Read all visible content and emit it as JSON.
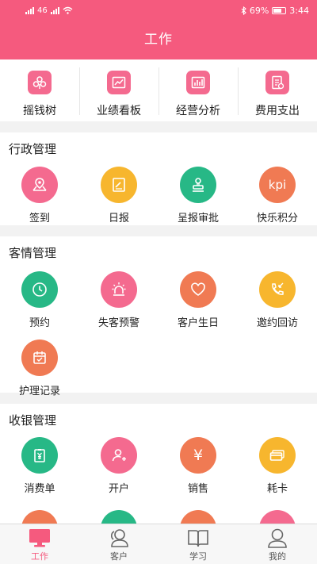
{
  "status_bar": {
    "left_text": "46",
    "battery": "69%",
    "time": "3:44"
  },
  "header": {
    "title": "工作"
  },
  "top_shortcuts": [
    {
      "label": "摇钱树",
      "icon": "money-tree-icon"
    },
    {
      "label": "业绩看板",
      "icon": "performance-chart-icon"
    },
    {
      "label": "经营分析",
      "icon": "bar-chart-icon"
    },
    {
      "label": "费用支出",
      "icon": "expense-icon"
    }
  ],
  "sections": {
    "admin": {
      "title": "行政管理",
      "items": [
        {
          "label": "签到",
          "icon": "location-pin-icon",
          "color": "#f46a8f"
        },
        {
          "label": "日报",
          "icon": "daily-report-icon",
          "color": "#f7b62e"
        },
        {
          "label": "呈报审批",
          "icon": "approval-stamp-icon",
          "color": "#27b886"
        },
        {
          "label": "快乐积分",
          "icon": "kpi-icon",
          "color": "#f07a53",
          "icon_text": "kpi"
        }
      ]
    },
    "customer": {
      "title": "客情管理",
      "items": [
        {
          "label": "预约",
          "icon": "clock-icon",
          "color": "#27b886"
        },
        {
          "label": "失客预警",
          "icon": "alarm-light-icon",
          "color": "#f46a8f"
        },
        {
          "label": "客户生日",
          "icon": "heart-icon",
          "color": "#f07a53"
        },
        {
          "label": "邀约回访",
          "icon": "phone-callback-icon",
          "color": "#f7b62e"
        },
        {
          "label": "护理记录",
          "icon": "calendar-icon",
          "color": "#f07a53"
        }
      ]
    },
    "cashier": {
      "title": "收银管理",
      "items": [
        {
          "label": "消费单",
          "icon": "receipt-icon",
          "color": "#27b886"
        },
        {
          "label": "开户",
          "icon": "add-user-icon",
          "color": "#f46a8f"
        },
        {
          "label": "销售",
          "icon": "yen-icon",
          "color": "#f07a53",
          "icon_text": "¥"
        },
        {
          "label": "耗卡",
          "icon": "card-icon",
          "color": "#f7b62e"
        }
      ],
      "row2_colors": [
        "#f07a53",
        "#27b886",
        "#f07a53",
        "#f46a8f"
      ]
    }
  },
  "tabbar": {
    "tabs": [
      {
        "label": "工作",
        "icon": "monitor-icon",
        "active": true
      },
      {
        "label": "客户",
        "icon": "customers-icon",
        "active": false
      },
      {
        "label": "学习",
        "icon": "book-icon",
        "active": false
      },
      {
        "label": "我的",
        "icon": "profile-icon",
        "active": false
      }
    ]
  },
  "colors": {
    "accent": "#f55a7e",
    "green": "#27b886",
    "yellow": "#f7b62e",
    "orange": "#f07a53",
    "pink": "#f46a8f"
  }
}
